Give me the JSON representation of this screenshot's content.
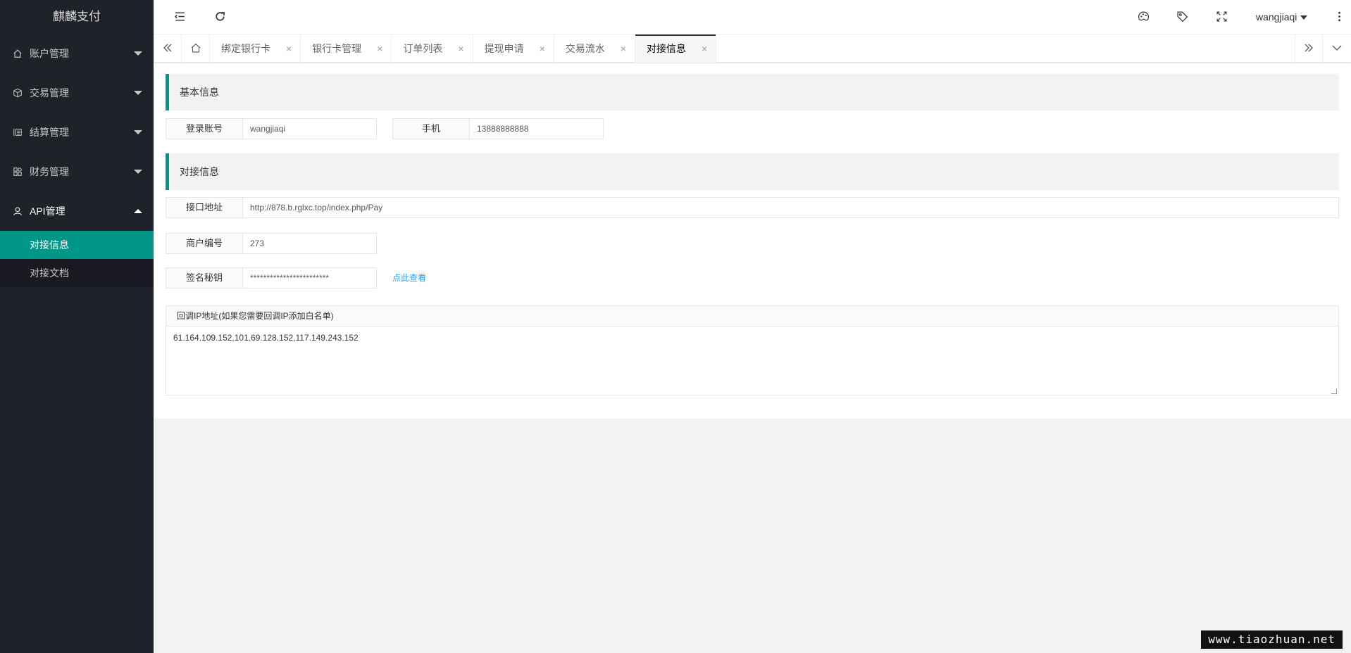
{
  "app": {
    "title": "麒麟支付"
  },
  "sidebar": {
    "groups": [
      {
        "label": "账户管理",
        "icon": "home-icon"
      },
      {
        "label": "交易管理",
        "icon": "cube-icon"
      },
      {
        "label": "结算管理",
        "icon": "list-icon"
      },
      {
        "label": "财务管理",
        "icon": "apps-icon"
      },
      {
        "label": "API管理",
        "icon": "user-icon",
        "open": true
      }
    ],
    "subitems": [
      {
        "label": "对接信息",
        "active": true
      },
      {
        "label": "对接文档",
        "active": false
      }
    ]
  },
  "header": {
    "user": "wangjiaqi",
    "icons": [
      "menu-shrink-icon",
      "refresh-icon",
      "theme-icon",
      "tag-icon",
      "fullscreen-icon",
      "more-icon"
    ]
  },
  "tabs": {
    "items": [
      {
        "label": "绑定银行卡"
      },
      {
        "label": "银行卡管理"
      },
      {
        "label": "订单列表"
      },
      {
        "label": "提现申请"
      },
      {
        "label": "交易流水"
      },
      {
        "label": "对接信息",
        "active": true
      }
    ],
    "close_glyph": "×"
  },
  "basic": {
    "title": "基本信息",
    "login_label": "登录账号",
    "login_value": "wangjiaqi",
    "phone_label": "手机",
    "phone_value": "13888888888"
  },
  "api": {
    "title": "对接信息",
    "url_label": "接口地址",
    "url_value": "http://878.b.rglxc.top/index.php/Pay",
    "merchant_label": "商户编号",
    "merchant_value": "273",
    "secret_label": "签名秘钥",
    "secret_value": "************************",
    "secret_link": "点此查看",
    "callback_label": "回调IP地址(如果您需要回调IP添加白名单)",
    "callback_value": "61.164.109.152,101.69.128.152,117.149.243.152"
  },
  "watermark": "www.tiaozhuan.net",
  "colors": {
    "accent": "#009688",
    "sidebar": "#20222a",
    "link": "#1e9fff"
  }
}
